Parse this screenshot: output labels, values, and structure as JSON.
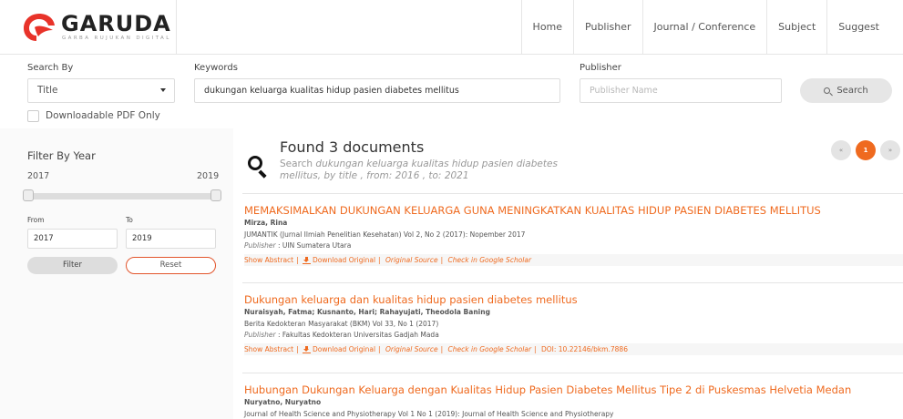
{
  "brand": {
    "name": "GARUDA",
    "tagline": "GARBA RUJUKAN DIGITAL",
    "accent": "#ef6a1f"
  },
  "nav": {
    "items": [
      "Home",
      "Publisher",
      "Journal / Conference",
      "Subject",
      "Suggest"
    ]
  },
  "search": {
    "search_by_label": "Search By",
    "search_by_value": "Title",
    "keywords_label": "Keywords",
    "keywords_value": "dukungan keluarga kualitas hidup pasien diabetes mellitus",
    "publisher_label": "Publisher",
    "publisher_placeholder": "Publisher Name",
    "button_label": "Search",
    "pdf_only_label": "Downloadable PDF Only"
  },
  "filter": {
    "title": "Filter By Year",
    "range_min": "2017",
    "range_max": "2019",
    "from_label": "From",
    "to_label": "To",
    "from_value": "2017",
    "to_value": "2019",
    "filter_label": "Filter",
    "reset_label": "Reset"
  },
  "results_header": {
    "found_text": "Found 3 documents",
    "search_prefix": "Search",
    "query_italic": "dukungan keluarga kualitas hidup pasien diabetes mellitus",
    "by_text": ", by title , from: 2016 , to: 2021"
  },
  "pagination": {
    "prev": "«",
    "current": "1",
    "next": "»"
  },
  "results": [
    {
      "title": "MEMAKSIMALKAN DUKUNGAN KELUARGA GUNA MENINGKATKAN KUALITAS HIDUP PASIEN DIABETES MELLITUS",
      "authors": "Mirza, Rina",
      "journal": "JUMANTIK (Jurnal Ilmiah Penelitian Kesehatan)  Vol 2, No 2 (2017): Nopember 2017",
      "publisher_label": "Publisher",
      "publisher": " : UIN Sumatera Utara",
      "show_abstract": "Show Abstract",
      "download": "Download Original",
      "original_source": "Original Source",
      "google_scholar": "Check in Google Scholar",
      "doi": ""
    },
    {
      "title": "Dukungan keluarga dan kualitas hidup pasien diabetes mellitus",
      "authors": "Nuraisyah, Fatma; Kusnanto, Hari; Rahayujati, Theodola Baning",
      "journal": "Berita Kedokteran Masyarakat (BKM) Vol 33, No 1 (2017)",
      "publisher_label": "Publisher",
      "publisher": " : Fakultas Kedokteran Universitas Gadjah Mada",
      "show_abstract": "Show Abstract",
      "download": "Download Original",
      "original_source": "Original Source",
      "google_scholar": "Check in Google Scholar",
      "doi": "DOI: 10.22146/bkm.7886"
    },
    {
      "title": "Hubungan Dukungan Keluarga dengan Kualitas Hidup Pasien Diabetes Mellitus Tipe 2 di Puskesmas Helvetia Medan",
      "authors": "Nuryatno, Nuryatno",
      "journal": "Journal of Health Science and Physiotherapy  Vol 1 No 1 (2019): Journal of Health Science and Physiotherapy"
    }
  ]
}
